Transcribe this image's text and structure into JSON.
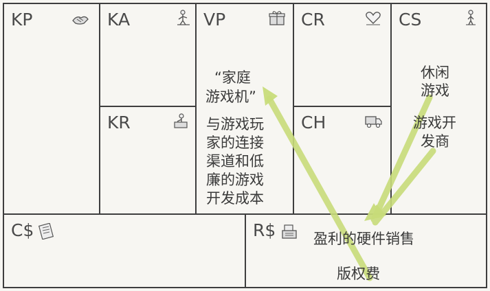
{
  "blocks": {
    "kp": {
      "code": "KP",
      "icon": "handshake-icon"
    },
    "ka": {
      "code": "KA",
      "icon": "worker-icon"
    },
    "kr": {
      "code": "KR",
      "icon": "resource-icon"
    },
    "vp": {
      "code": "VP",
      "icon": "gift-icon",
      "line1": "“家庭",
      "line2": "游戏机”",
      "desc": [
        "与游戏玩",
        "家的连接",
        "渠道和低",
        "廉的游戏",
        "开发成本"
      ]
    },
    "cr": {
      "code": "CR",
      "icon": "heart-icon"
    },
    "ch": {
      "code": "CH",
      "icon": "truck-icon"
    },
    "cs": {
      "code": "CS",
      "icon": "person-icon",
      "seg1": [
        "休闲",
        "游戏"
      ],
      "seg2": [
        "游戏开",
        "发商"
      ]
    },
    "cost": {
      "code": "C$",
      "icon": "receipt-icon"
    },
    "rev": {
      "code": "R$",
      "icon": "cash-register-icon",
      "item1": "盈利的硬件销售",
      "item2": "版权费"
    }
  },
  "colors": {
    "border": "#3e3e3e",
    "arrow": "#c8dc7a",
    "background": "#f7f6f2"
  }
}
